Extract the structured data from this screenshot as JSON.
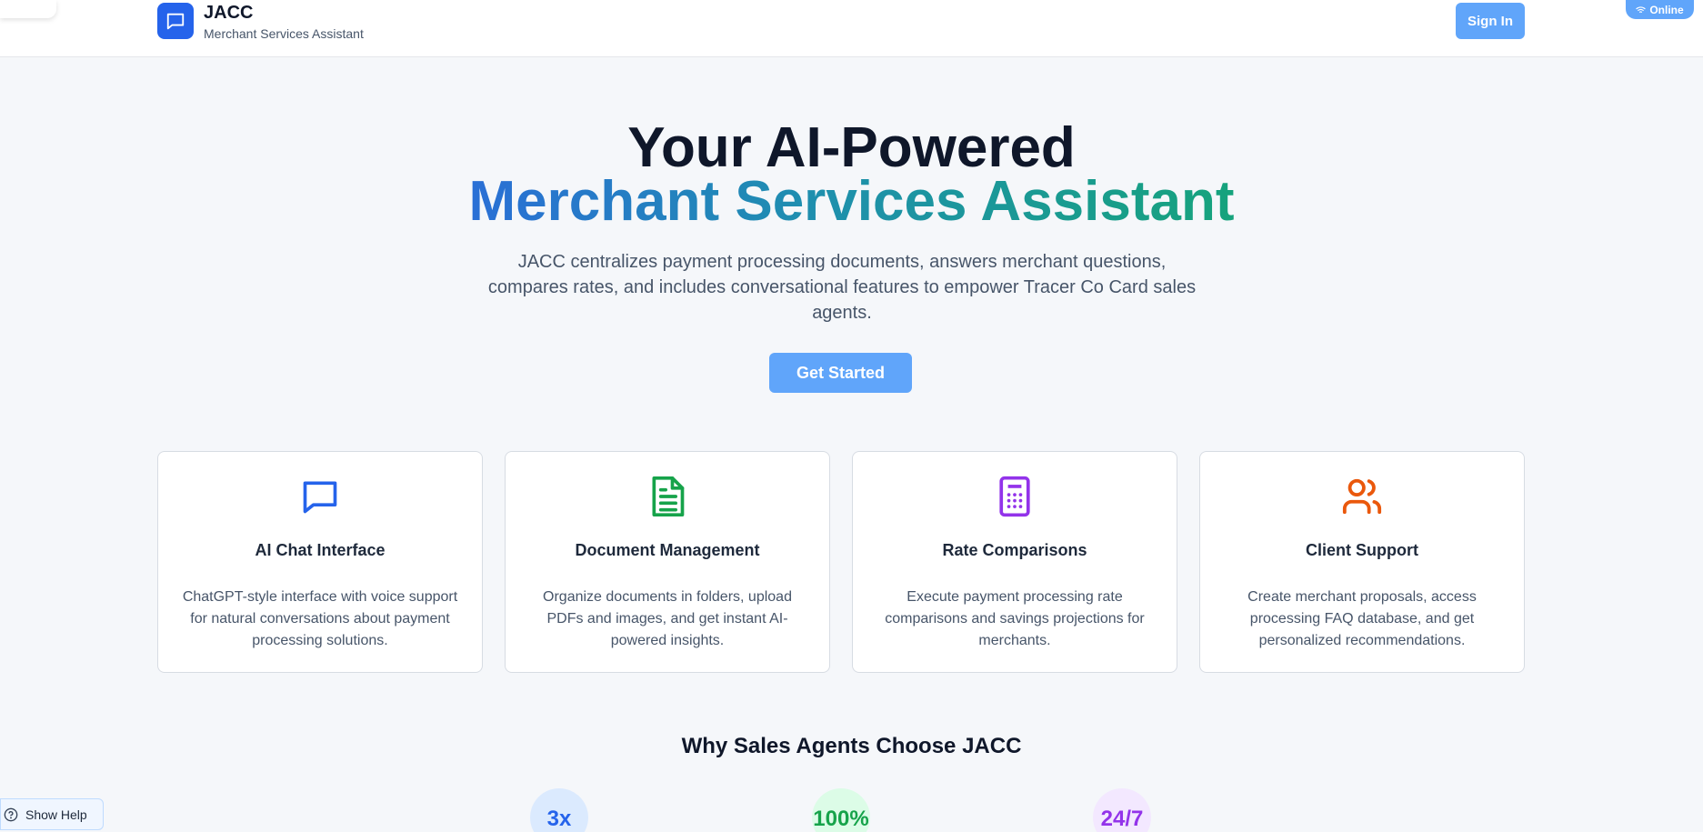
{
  "header": {
    "brand_title": "JACC",
    "brand_subtitle": "Merchant Services Assistant",
    "signin_label": "Sign In",
    "status_label": "Online"
  },
  "hero": {
    "line1": "Your AI-Powered",
    "line2": "Merchant Services Assistant",
    "description": "JACC centralizes payment processing documents, answers merchant questions, compares rates, and includes conversational features to empower Tracer Co Card sales agents.",
    "cta_label": "Get Started"
  },
  "features": [
    {
      "title": "AI Chat Interface",
      "description": "ChatGPT-style interface with voice support for natural conversations about payment processing solutions.",
      "icon": "chat-bubble-icon",
      "color": "#2563eb"
    },
    {
      "title": "Document Management",
      "description": "Organize documents in folders, upload PDFs and images, and get instant AI-powered insights.",
      "icon": "document-icon",
      "color": "#16a34a"
    },
    {
      "title": "Rate Comparisons",
      "description": "Execute payment processing rate comparisons and savings projections for merchants.",
      "icon": "calculator-icon",
      "color": "#9333ea"
    },
    {
      "title": "Client Support",
      "description": "Create merchant proposals, access processing FAQ database, and get personalized recommendations.",
      "icon": "users-icon",
      "color": "#ea580c"
    }
  ],
  "why": {
    "title": "Why Sales Agents Choose JACC",
    "stats": [
      {
        "value": "3x",
        "color": "#2563eb",
        "bg": "#dbeafe"
      },
      {
        "value": "100%",
        "color": "#16a34a",
        "bg": "#dcfce7"
      },
      {
        "value": "24/7",
        "color": "#9333ea",
        "bg": "#f3e8ff"
      }
    ]
  },
  "help": {
    "label": "Show Help"
  },
  "colors": {
    "accent": "#60a5fa",
    "brand": "#2563eb"
  }
}
